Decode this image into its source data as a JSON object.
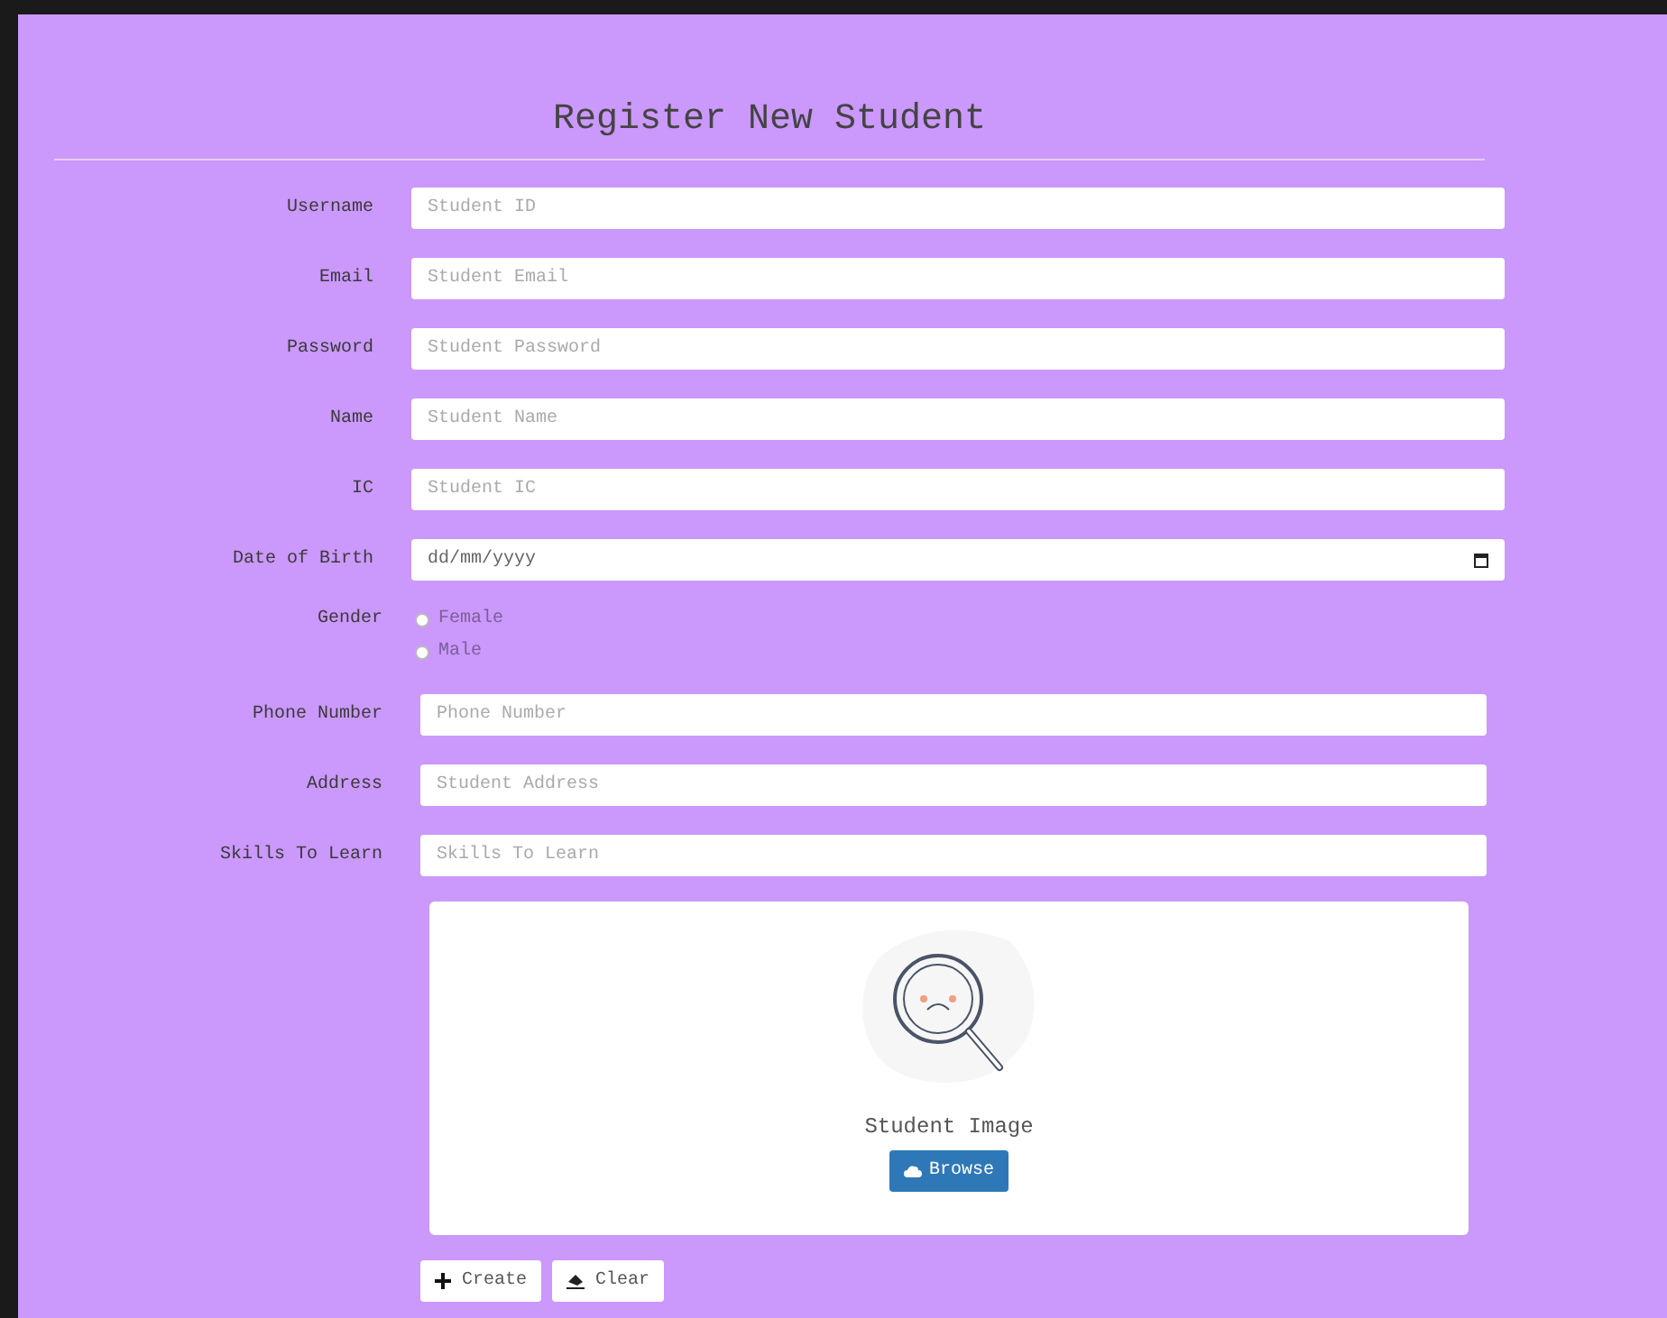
{
  "title": "Register New Student",
  "groups": [
    {
      "fields": [
        {
          "kind": "text",
          "label": "Username",
          "placeholder": "Student ID"
        },
        {
          "kind": "text",
          "label": "Email",
          "placeholder": "Student Email"
        },
        {
          "kind": "text",
          "label": "Password",
          "placeholder": "Student Password"
        },
        {
          "kind": "text",
          "label": "Name",
          "placeholder": "Student Name"
        },
        {
          "kind": "text",
          "label": "IC",
          "placeholder": "Student IC"
        },
        {
          "kind": "date",
          "label": "Date of Birth",
          "placeholder": "dd/mm/yyyy"
        }
      ]
    },
    {
      "fields": [
        {
          "kind": "radio",
          "label": "Gender",
          "options": [
            {
              "label": "Female",
              "selected": false
            },
            {
              "label": "Male",
              "selected": false
            }
          ]
        },
        {
          "kind": "text",
          "label": "Phone Number",
          "placeholder": "Phone Number"
        },
        {
          "kind": "text",
          "label": "Address",
          "placeholder": "Student Address"
        },
        {
          "kind": "text",
          "label": "Skills To Learn",
          "placeholder": "Skills To Learn"
        }
      ]
    }
  ],
  "image_upload": {
    "caption": "Student Image",
    "button": "Browse"
  },
  "buttons": [
    {
      "kind": "create",
      "label": "Create"
    },
    {
      "kind": "clear",
      "label": "Clear"
    }
  ]
}
